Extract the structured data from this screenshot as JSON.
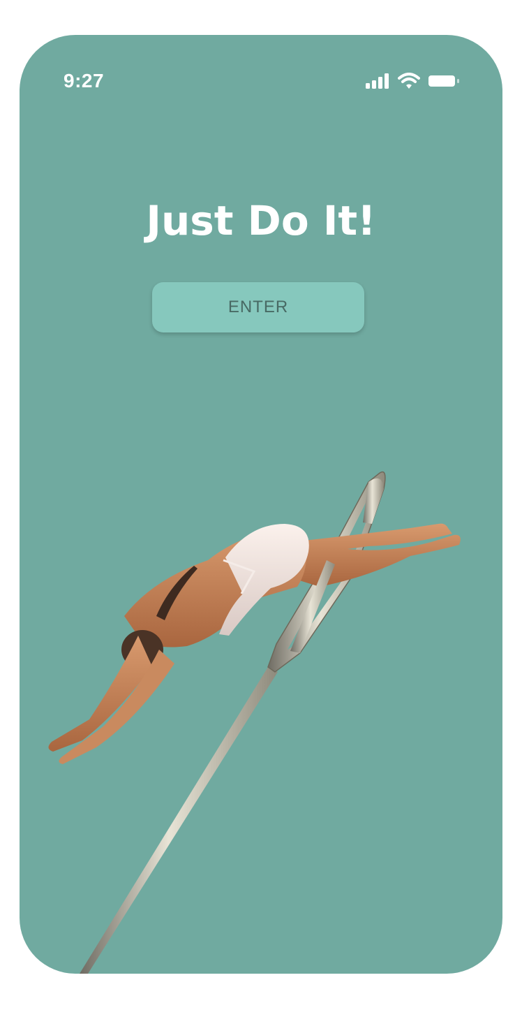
{
  "status_bar": {
    "time": "9:27",
    "icons": [
      "signal-icon",
      "wifi-icon",
      "battery-icon"
    ]
  },
  "main": {
    "title": "Just Do It!",
    "enter_label": "ENTER"
  },
  "hero_image": {
    "subject": "diver-through-needle-eye"
  },
  "colors": {
    "background": "#70aaa0",
    "button": "#86c8bd",
    "button_text": "#486a64",
    "title": "#ffffff"
  }
}
